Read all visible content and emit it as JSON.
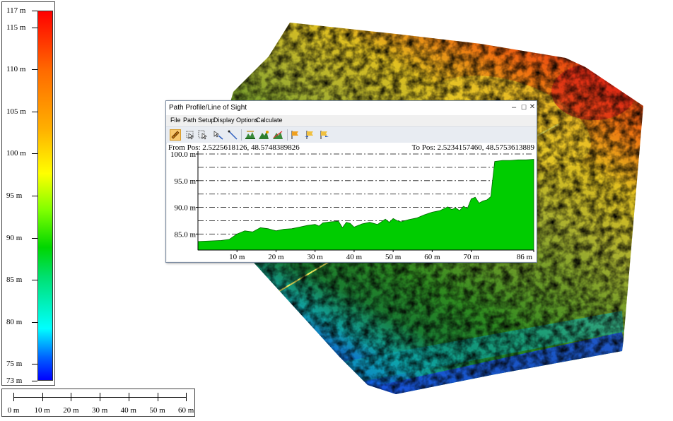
{
  "legend": {
    "labels": [
      "117 m",
      "115 m",
      "110 m",
      "105 m",
      "100 m",
      "95 m",
      "90 m",
      "85 m",
      "80 m",
      "75 m",
      "73 m"
    ]
  },
  "scale": {
    "labels": [
      "0 m",
      "10 m",
      "20 m",
      "30 m",
      "40 m",
      "50 m",
      "60 m"
    ]
  },
  "dialog": {
    "title": "Path Profile/Line of Sight",
    "menu": [
      "File",
      "Path Setup",
      "Display Options",
      "Calculate"
    ],
    "window_buttons": [
      "–",
      "☐",
      "✕"
    ],
    "from_pos": "From Pos: 2.5225618126, 48.5748389826",
    "to_pos": "To Pos: 2.5234157460, 48.5753613889",
    "toolbar_icons": [
      "ruler-icon",
      "select-point-icon",
      "select-area-icon",
      "draw-path-icon",
      "line-icon",
      "terrain-icon",
      "terrain-view-icon",
      "line-of-sight-icon",
      "flag-icon",
      "flag-left-icon",
      "flag-right-icon"
    ]
  },
  "colors": {
    "profile_fill": "#00cc00",
    "grid": "#444444"
  },
  "chart_data": {
    "type": "area",
    "y_ticks": [
      "100.0 m",
      "95.0 m",
      "90.0 m",
      "85.0 m"
    ],
    "x_ticks": [
      "10 m",
      "20 m",
      "30 m",
      "40 m",
      "50 m",
      "60 m",
      "70 m",
      "86 m"
    ],
    "ylim": [
      82,
      100
    ],
    "xlim": [
      0,
      86
    ],
    "x": [
      0,
      3,
      6,
      8,
      10,
      12,
      14,
      16,
      18,
      20,
      22,
      24,
      26,
      28,
      30,
      31,
      32,
      34,
      36,
      37,
      38,
      39,
      40,
      42,
      44,
      46,
      48,
      49,
      50,
      51,
      52,
      54,
      56,
      58,
      60,
      62,
      64,
      65,
      66,
      67,
      68,
      69,
      70,
      71,
      72,
      73,
      74,
      75,
      76,
      78,
      80,
      82,
      84,
      86
    ],
    "y": [
      83.6,
      83.7,
      83.8,
      84.0,
      85.0,
      85.6,
      85.4,
      86.2,
      86.0,
      85.6,
      85.9,
      86.0,
      86.3,
      86.6,
      86.8,
      86.5,
      87.1,
      87.3,
      87.4,
      86.2,
      87.2,
      87.0,
      86.3,
      86.9,
      87.2,
      86.8,
      87.8,
      87.2,
      87.9,
      87.5,
      87.3,
      87.7,
      88.0,
      88.6,
      89.1,
      89.4,
      90.1,
      89.6,
      89.9,
      89.4,
      90.2,
      89.8,
      91.6,
      91.9,
      90.8,
      91.2,
      91.4,
      92.0,
      98.6,
      98.8,
      98.8,
      98.9,
      98.9,
      99.0
    ]
  }
}
